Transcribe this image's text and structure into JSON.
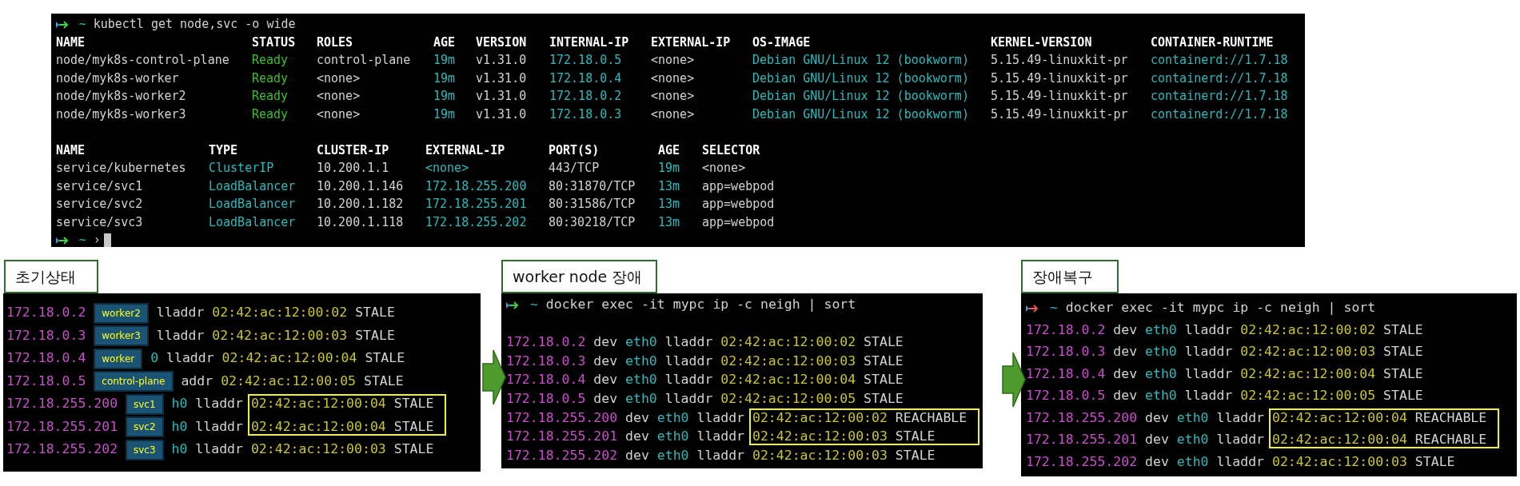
{
  "cluster_terminal": {
    "prompt": {
      "failed": false,
      "cwd": "~",
      "command": "kubectl get node,svc -o wide"
    },
    "nodes": {
      "columns": [
        {
          "label": "NAME",
          "kind": "plain"
        },
        {
          "label": "STATUS",
          "kind": "status"
        },
        {
          "label": "ROLES",
          "kind": "plain"
        },
        {
          "label": "AGE",
          "kind": "accent"
        },
        {
          "label": "VERSION",
          "kind": "plain"
        },
        {
          "label": "INTERNAL-IP",
          "kind": "accent"
        },
        {
          "label": "EXTERNAL-IP",
          "kind": "plain"
        },
        {
          "label": "OS-IMAGE",
          "kind": "accent"
        },
        {
          "label": "KERNEL-VERSION",
          "kind": "plain"
        },
        {
          "label": "CONTAINER-RUNTIME",
          "kind": "accent"
        }
      ],
      "rows": [
        [
          "node/myk8s-control-plane",
          "Ready",
          "control-plane",
          "19m",
          "v1.31.0",
          "172.18.0.5",
          "<none>",
          "Debian GNU/Linux 12 (bookworm)",
          "5.15.49-linuxkit-pr",
          "containerd://1.7.18"
        ],
        [
          "node/myk8s-worker",
          "Ready",
          "<none>",
          "19m",
          "v1.31.0",
          "172.18.0.4",
          "<none>",
          "Debian GNU/Linux 12 (bookworm)",
          "5.15.49-linuxkit-pr",
          "containerd://1.7.18"
        ],
        [
          "node/myk8s-worker2",
          "Ready",
          "<none>",
          "19m",
          "v1.31.0",
          "172.18.0.2",
          "<none>",
          "Debian GNU/Linux 12 (bookworm)",
          "5.15.49-linuxkit-pr",
          "containerd://1.7.18"
        ],
        [
          "node/myk8s-worker3",
          "Ready",
          "<none>",
          "19m",
          "v1.31.0",
          "172.18.0.3",
          "<none>",
          "Debian GNU/Linux 12 (bookworm)",
          "5.15.49-linuxkit-pr",
          "containerd://1.7.18"
        ]
      ]
    },
    "services": {
      "columns": [
        {
          "label": "NAME",
          "kind": "plain"
        },
        {
          "label": "TYPE",
          "kind": "accent"
        },
        {
          "label": "CLUSTER-IP",
          "kind": "plain"
        },
        {
          "label": "EXTERNAL-IP",
          "kind": "accent"
        },
        {
          "label": "PORT(S)",
          "kind": "plain"
        },
        {
          "label": "AGE",
          "kind": "accent"
        },
        {
          "label": "SELECTOR",
          "kind": "plain"
        }
      ],
      "rows": [
        [
          "service/kubernetes",
          "ClusterIP",
          "10.200.1.1",
          "<none>",
          "443/TCP",
          "19m",
          "<none>"
        ],
        [
          "service/svc1",
          "LoadBalancer",
          "10.200.1.146",
          "172.18.255.200",
          "80:31870/TCP",
          "13m",
          "app=webpod"
        ],
        [
          "service/svc2",
          "LoadBalancer",
          "10.200.1.182",
          "172.18.255.201",
          "80:31586/TCP",
          "13m",
          "app=webpod"
        ],
        [
          "service/svc3",
          "LoadBalancer",
          "10.200.1.118",
          "172.18.255.202",
          "80:30218/TCP",
          "13m",
          "app=webpod"
        ]
      ]
    },
    "final_prompt": {
      "failed": false,
      "cwd": "~",
      "symbol": "›",
      "cursor": true
    }
  },
  "panels": [
    {
      "title": "초기상태",
      "rows": [
        {
          "ip": "172.18.0.2",
          "tag": "worker2",
          "lladdr": "lladdr",
          "mac": "02:42:ac:12:00:02",
          "state": "STALE",
          "highlighted": false
        },
        {
          "ip": "172.18.0.3",
          "tag": "worker3",
          "lladdr": "lladdr",
          "mac": "02:42:ac:12:00:03",
          "state": "STALE",
          "highlighted": false
        },
        {
          "ip": "172.18.0.4",
          "tag": "worker",
          "iface": "0",
          "lladdr": "lladdr",
          "mac": "02:42:ac:12:00:04",
          "state": "STALE",
          "highlighted": false
        },
        {
          "ip": "172.18.0.5",
          "tag": "control-plane",
          "lladdr": "addr",
          "mac": "02:42:ac:12:00:05",
          "state": "STALE",
          "highlighted": false
        },
        {
          "ip": "172.18.255.200",
          "tag": "svc1",
          "iface": "h0",
          "lladdr": "lladdr",
          "mac": "02:42:ac:12:00:04",
          "state": "STALE",
          "highlighted": true
        },
        {
          "ip": "172.18.255.201",
          "tag": "svc2",
          "iface": "h0",
          "lladdr": "lladdr",
          "mac": "02:42:ac:12:00:04",
          "state": "STALE",
          "highlighted": true
        },
        {
          "ip": "172.18.255.202",
          "tag": "svc3",
          "iface": "h0",
          "lladdr": "lladdr",
          "mac": "02:42:ac:12:00:03",
          "state": "STALE",
          "highlighted": false
        }
      ]
    },
    {
      "title": "worker node 장애",
      "prompt": {
        "failed": false,
        "cwd": "~",
        "command": "docker exec -it mypc ip -c neigh | sort",
        "blank_line": true
      },
      "rows": [
        {
          "ip": "172.18.0.2",
          "dev": "dev",
          "iface": "eth0",
          "lladdr": "lladdr",
          "mac": "02:42:ac:12:00:02",
          "state": "STALE",
          "highlighted": false
        },
        {
          "ip": "172.18.0.3",
          "dev": "dev",
          "iface": "eth0",
          "lladdr": "lladdr",
          "mac": "02:42:ac:12:00:03",
          "state": "STALE",
          "highlighted": false
        },
        {
          "ip": "172.18.0.4",
          "dev": "dev",
          "iface": "eth0",
          "lladdr": "lladdr",
          "mac": "02:42:ac:12:00:04",
          "state": "STALE",
          "highlighted": false
        },
        {
          "ip": "172.18.0.5",
          "dev": "dev",
          "iface": "eth0",
          "lladdr": "lladdr",
          "mac": "02:42:ac:12:00:05",
          "state": "STALE",
          "highlighted": false
        },
        {
          "ip": "172.18.255.200",
          "dev": "dev",
          "iface": "eth0",
          "lladdr": "lladdr",
          "mac": "02:42:ac:12:00:02",
          "state": "REACHABLE",
          "highlighted": true
        },
        {
          "ip": "172.18.255.201",
          "dev": "dev",
          "iface": "eth0",
          "lladdr": "lladdr",
          "mac": "02:42:ac:12:00:03",
          "state": "STALE",
          "highlighted": true
        },
        {
          "ip": "172.18.255.202",
          "dev": "dev",
          "iface": "eth0",
          "lladdr": "lladdr",
          "mac": "02:42:ac:12:00:03",
          "state": "STALE",
          "highlighted": false
        }
      ]
    },
    {
      "title": "장애복구",
      "prompt": {
        "failed": true,
        "cwd": "~",
        "command": "docker exec -it mypc ip -c neigh | sort",
        "blank_line": false
      },
      "rows": [
        {
          "ip": "172.18.0.2",
          "dev": "dev",
          "iface": "eth0",
          "lladdr": "lladdr",
          "mac": "02:42:ac:12:00:02",
          "state": "STALE",
          "highlighted": false
        },
        {
          "ip": "172.18.0.3",
          "dev": "dev",
          "iface": "eth0",
          "lladdr": "lladdr",
          "mac": "02:42:ac:12:00:03",
          "state": "STALE",
          "highlighted": false
        },
        {
          "ip": "172.18.0.4",
          "dev": "dev",
          "iface": "eth0",
          "lladdr": "lladdr",
          "mac": "02:42:ac:12:00:04",
          "state": "STALE",
          "highlighted": false
        },
        {
          "ip": "172.18.0.5",
          "dev": "dev",
          "iface": "eth0",
          "lladdr": "lladdr",
          "mac": "02:42:ac:12:00:05",
          "state": "STALE",
          "highlighted": false
        },
        {
          "ip": "172.18.255.200",
          "dev": "dev",
          "iface": "eth0",
          "lladdr": "lladdr",
          "mac": "02:42:ac:12:00:04",
          "state": "REACHABLE",
          "highlighted": true
        },
        {
          "ip": "172.18.255.201",
          "dev": "dev",
          "iface": "eth0",
          "lladdr": "lladdr",
          "mac": "02:42:ac:12:00:04",
          "state": "REACHABLE",
          "highlighted": true
        },
        {
          "ip": "172.18.255.202",
          "dev": "dev",
          "iface": "eth0",
          "lladdr": "lladdr",
          "mac": "02:42:ac:12:00:03",
          "state": "STALE",
          "highlighted": false
        }
      ]
    }
  ]
}
